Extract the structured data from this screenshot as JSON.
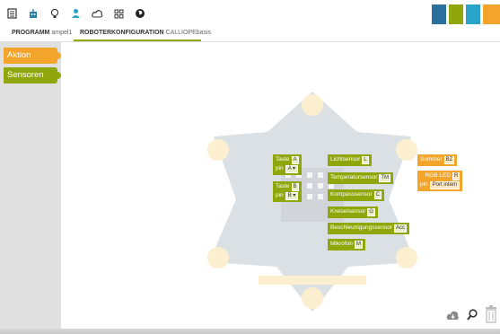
{
  "toolbar": {
    "icons": [
      "file-icon",
      "robot-icon",
      "lightbulb-icon",
      "user-icon",
      "cloud-icon",
      "grid-icon",
      "globe-icon"
    ]
  },
  "tabs": {
    "program_label": "PROGRAMM",
    "program_name": "ampel1",
    "config_label": "ROBOTERKONFIGURATION",
    "config_name": "CALLIOPEbasis"
  },
  "sidebar": {
    "items": [
      {
        "label": "Aktion",
        "color": "#f2a42b"
      },
      {
        "label": "Sensoren",
        "color": "#8fa70b"
      }
    ]
  },
  "blocks": {
    "taste_a": {
      "label": "Taste",
      "id": "A",
      "pin_label": "pin",
      "pin_value": "A ▾"
    },
    "taste_b": {
      "label": "Taste",
      "id": "B",
      "pin_label": "pin",
      "pin_value": "B ▾"
    },
    "lichtsensor": {
      "label": "Lichtsensor",
      "id": "L"
    },
    "temperatursensor": {
      "label": "Temperatursensor",
      "id": "TM"
    },
    "kompasssensor": {
      "label": "Kompasssensor",
      "id": "C"
    },
    "kreiselsensor": {
      "label": "Kreiselsensor",
      "id": "G"
    },
    "beschleunigungssensor": {
      "label": "Beschleunigungssensor",
      "id": "Acc"
    },
    "mikrofon": {
      "label": "Mikrofon",
      "id": "M"
    },
    "summer": {
      "label": "Summer",
      "id": "BZ"
    },
    "rgb_led": {
      "label": "RGB LED",
      "id": "R",
      "pin_label": "pin",
      "pin_value": "Port intern"
    }
  },
  "colors": {
    "sensor": "#8fa70b",
    "action": "#f2a42b",
    "sidebar": "#e0e0e0"
  },
  "controls": [
    "cloud-download-icon",
    "zoom-icon",
    "trash-icon"
  ]
}
